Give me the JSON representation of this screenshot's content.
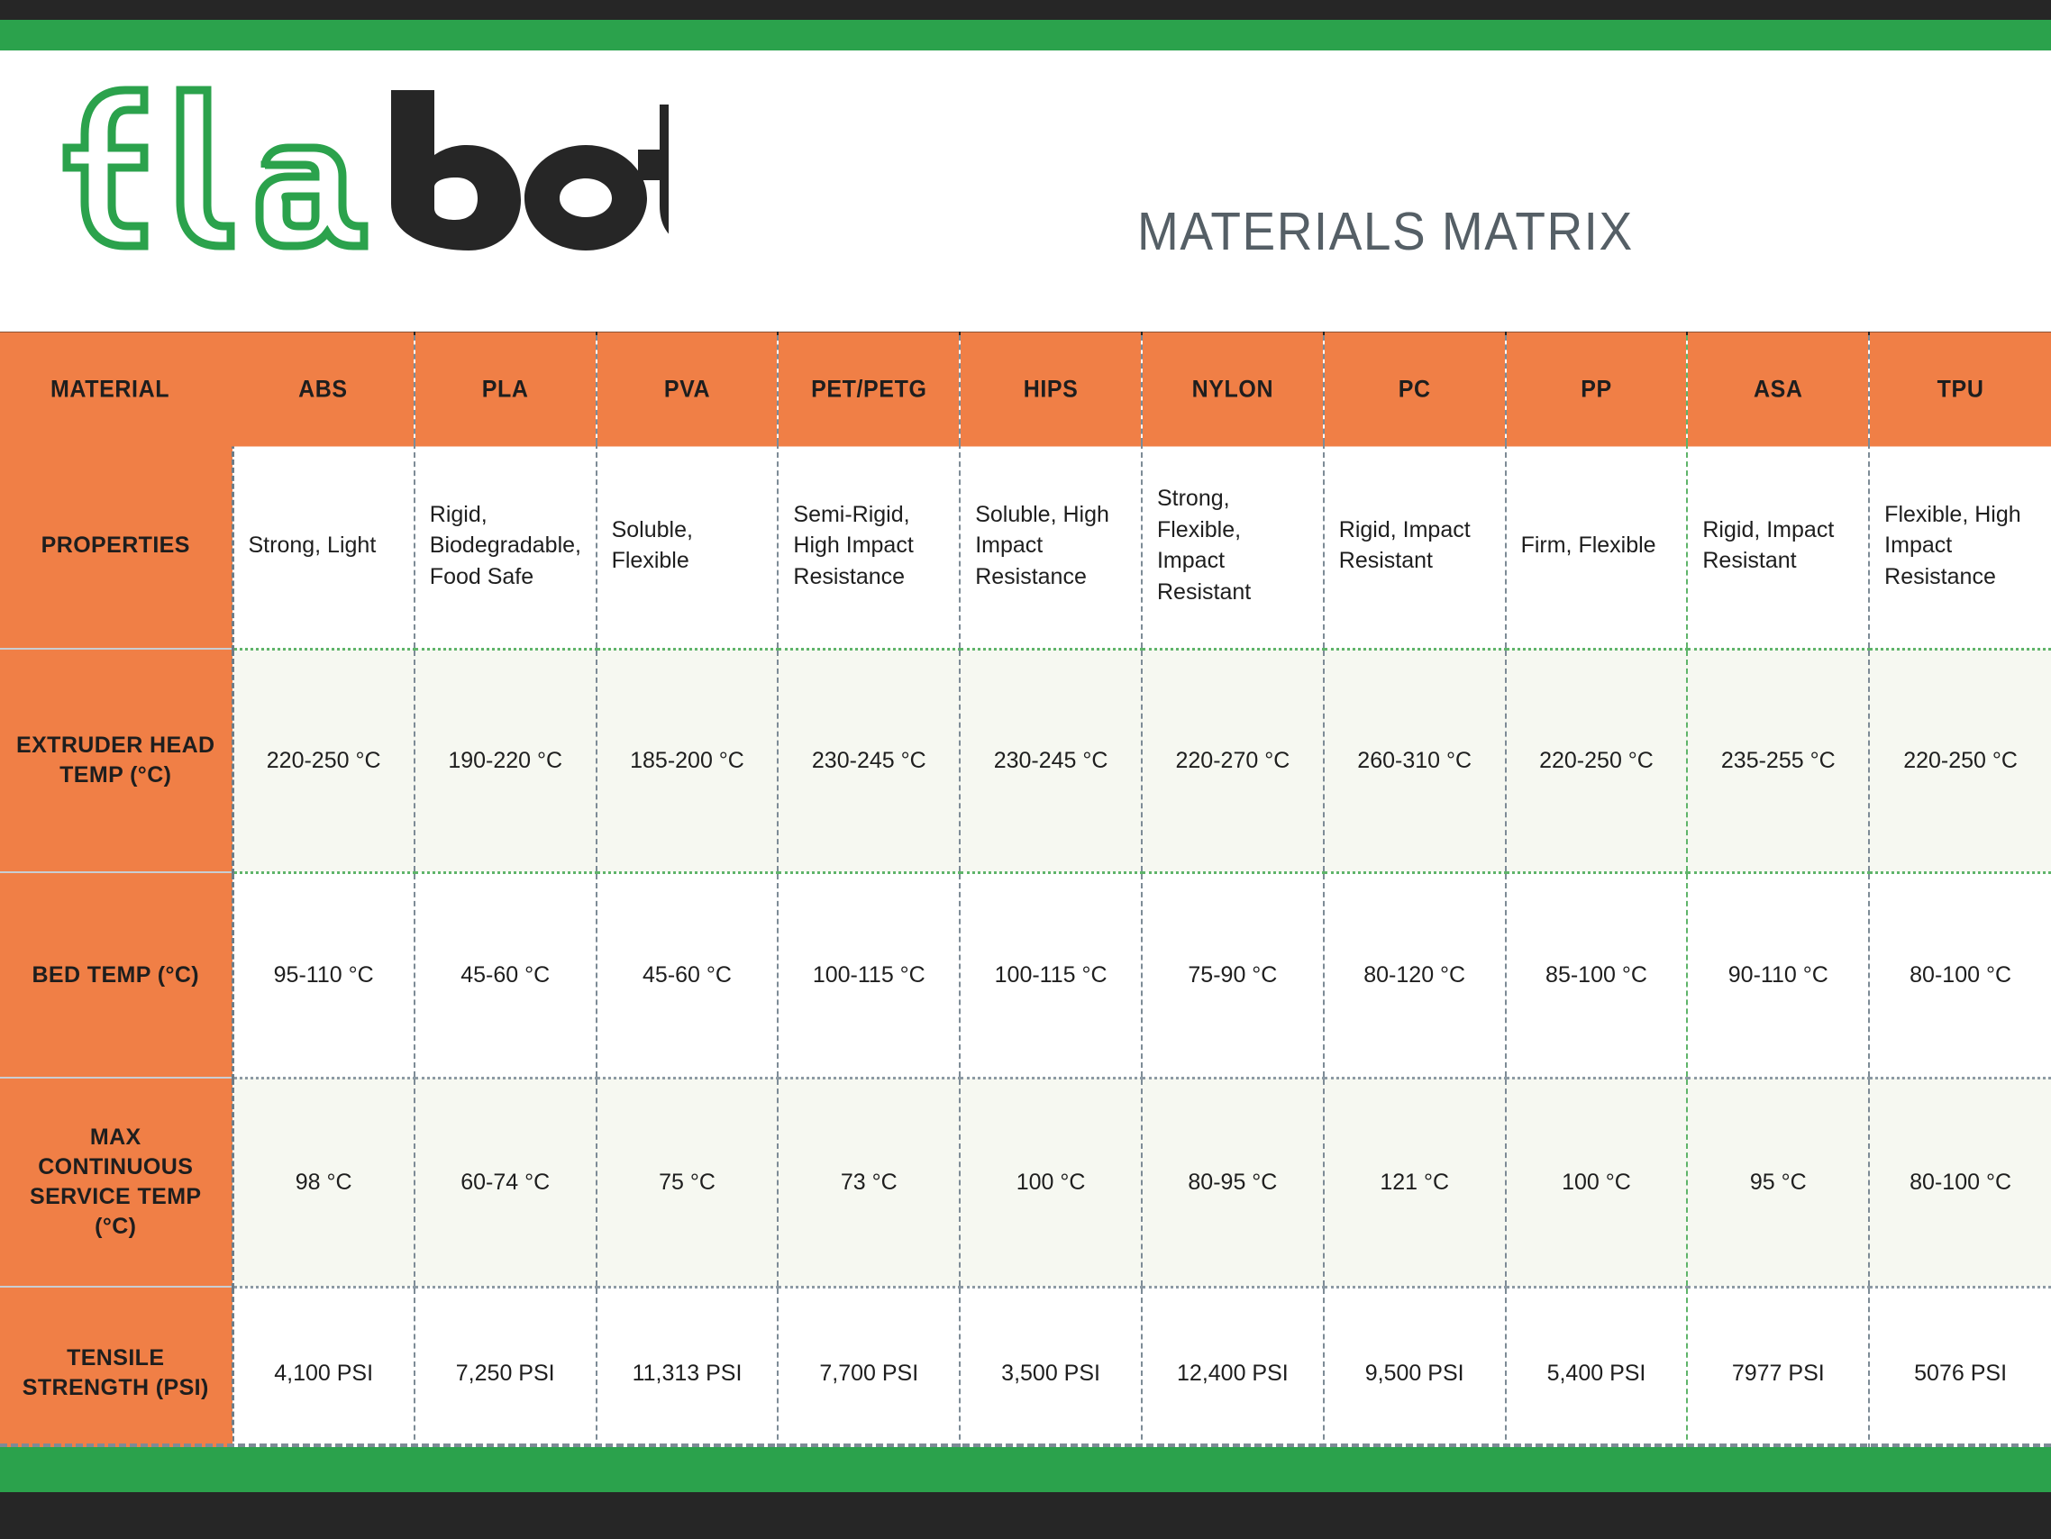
{
  "brand": {
    "logo_text": "filabot",
    "logo_green_part": "fila",
    "logo_dark_part": "bot",
    "green": "#2BA24C",
    "dark": "#262626"
  },
  "header": {
    "title": "MATERIALS MATRIX",
    "title_color": "#555F66"
  },
  "theme": {
    "orange": "#F07F46",
    "green": "#2BA24C",
    "dark": "#262626",
    "shaded_row": "#F6F8F1",
    "divider_gray": "#7D8B96",
    "divider_green": "#5FB46A"
  },
  "table": {
    "columns": [
      "MATERIAL",
      "ABS",
      "PLA",
      "PVA",
      "PET/PETG",
      "HIPS",
      "NYLON",
      "PC",
      "PP",
      "ASA",
      "TPU"
    ],
    "rows": [
      {
        "label": "PROPERTIES",
        "align": "left",
        "values": [
          "Strong, Light",
          "Rigid, Biodegradable, Food Safe",
          "Soluble, Flexible",
          "Semi-Rigid, High Impact Resistance",
          "Soluble, High Impact Resistance",
          "Strong, Flexible, Impact Resistant",
          "Rigid, Impact Resistant",
          "Firm, Flexible",
          "Rigid, Impact Resistant",
          "Flexible, High Impact Resistance"
        ]
      },
      {
        "label": "EXTRUDER HEAD TEMP (°C)",
        "align": "center",
        "values": [
          "220-250 °C",
          "190-220 °C",
          "185-200 °C",
          "230-245 °C",
          "230-245 °C",
          "220-270 °C",
          "260-310 °C",
          "220-250 °C",
          "235-255 °C",
          "220-250 °C"
        ]
      },
      {
        "label": "BED TEMP (°C)",
        "align": "center",
        "values": [
          "95-110 °C",
          "45-60 °C",
          "45-60 °C",
          "100-115 °C",
          "100-115 °C",
          "75-90 °C",
          "80-120 °C",
          "85-100 °C",
          "90-110 °C",
          "80-100 °C"
        ]
      },
      {
        "label": "MAX CONTINUOUS SERVICE TEMP (°C)",
        "align": "center",
        "values": [
          "98 °C",
          "60-74 °C",
          "75 °C",
          "73 °C",
          "100 °C",
          "80-95 °C",
          "121 °C",
          "100 °C",
          "95 °C",
          "80-100 °C"
        ]
      },
      {
        "label": "TENSILE STRENGTH (PSI)",
        "align": "center",
        "values": [
          "4,100 PSI",
          "7,250 PSI",
          "11,313 PSI",
          "7,700 PSI",
          "3,500 PSI",
          "12,400 PSI",
          "9,500 PSI",
          "5,400 PSI",
          "7977 PSI",
          "5076 PSI"
        ]
      }
    ]
  }
}
